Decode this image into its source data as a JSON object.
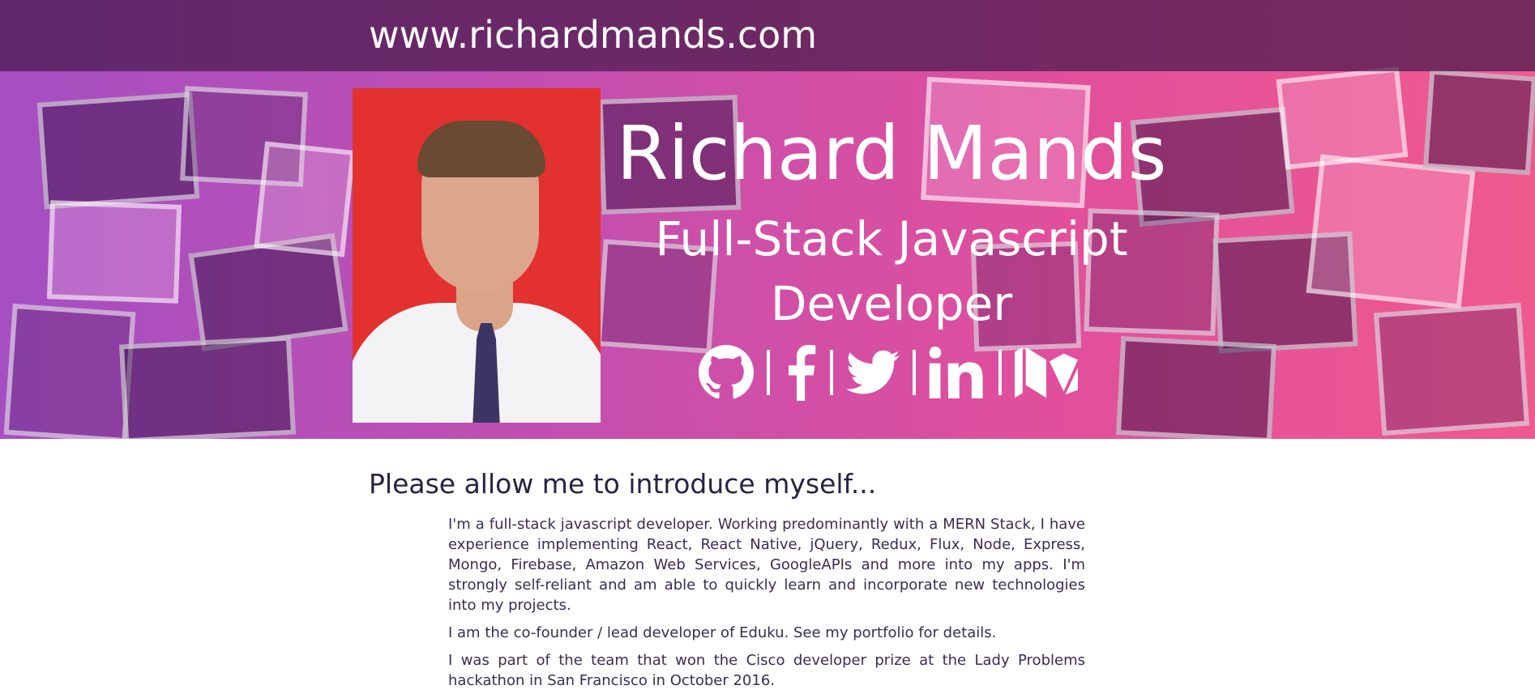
{
  "header": {
    "site_url": "www.richardmands.com"
  },
  "profile": {
    "name": "Richard Mands",
    "role_line1": "Full-Stack Javascript",
    "role_line2": "Developer"
  },
  "social": {
    "icons": [
      "github-icon",
      "facebook-icon",
      "twitter-icon",
      "linkedin-icon",
      "medium-icon"
    ],
    "icon_color": "#ffffff"
  },
  "intro": {
    "title": "Please allow me to introduce myself...",
    "paragraphs": [
      "I'm a full-stack javascript developer. Working predominantly with a MERN Stack, I have experience implementing React, React Native, jQuery, Redux, Flux, Node, Express, Mongo, Firebase, Amazon Web Services, GoogleAPIs and more into my apps. I'm strongly self-reliant and am able to quickly learn and incorporate new technologies into my projects.",
      "I am the co-founder / lead developer of Eduku. See my portfolio for details.",
      "I was part of the team that won the Cisco developer prize at the Lady Problems hackathon in San Francisco in October 2016."
    ]
  },
  "colors": {
    "hero_gradient_start": "#a54fc3",
    "hero_gradient_end": "#ef5a8e",
    "profile_photo_background": "#e3312f",
    "text_dark": "#2b2140"
  }
}
